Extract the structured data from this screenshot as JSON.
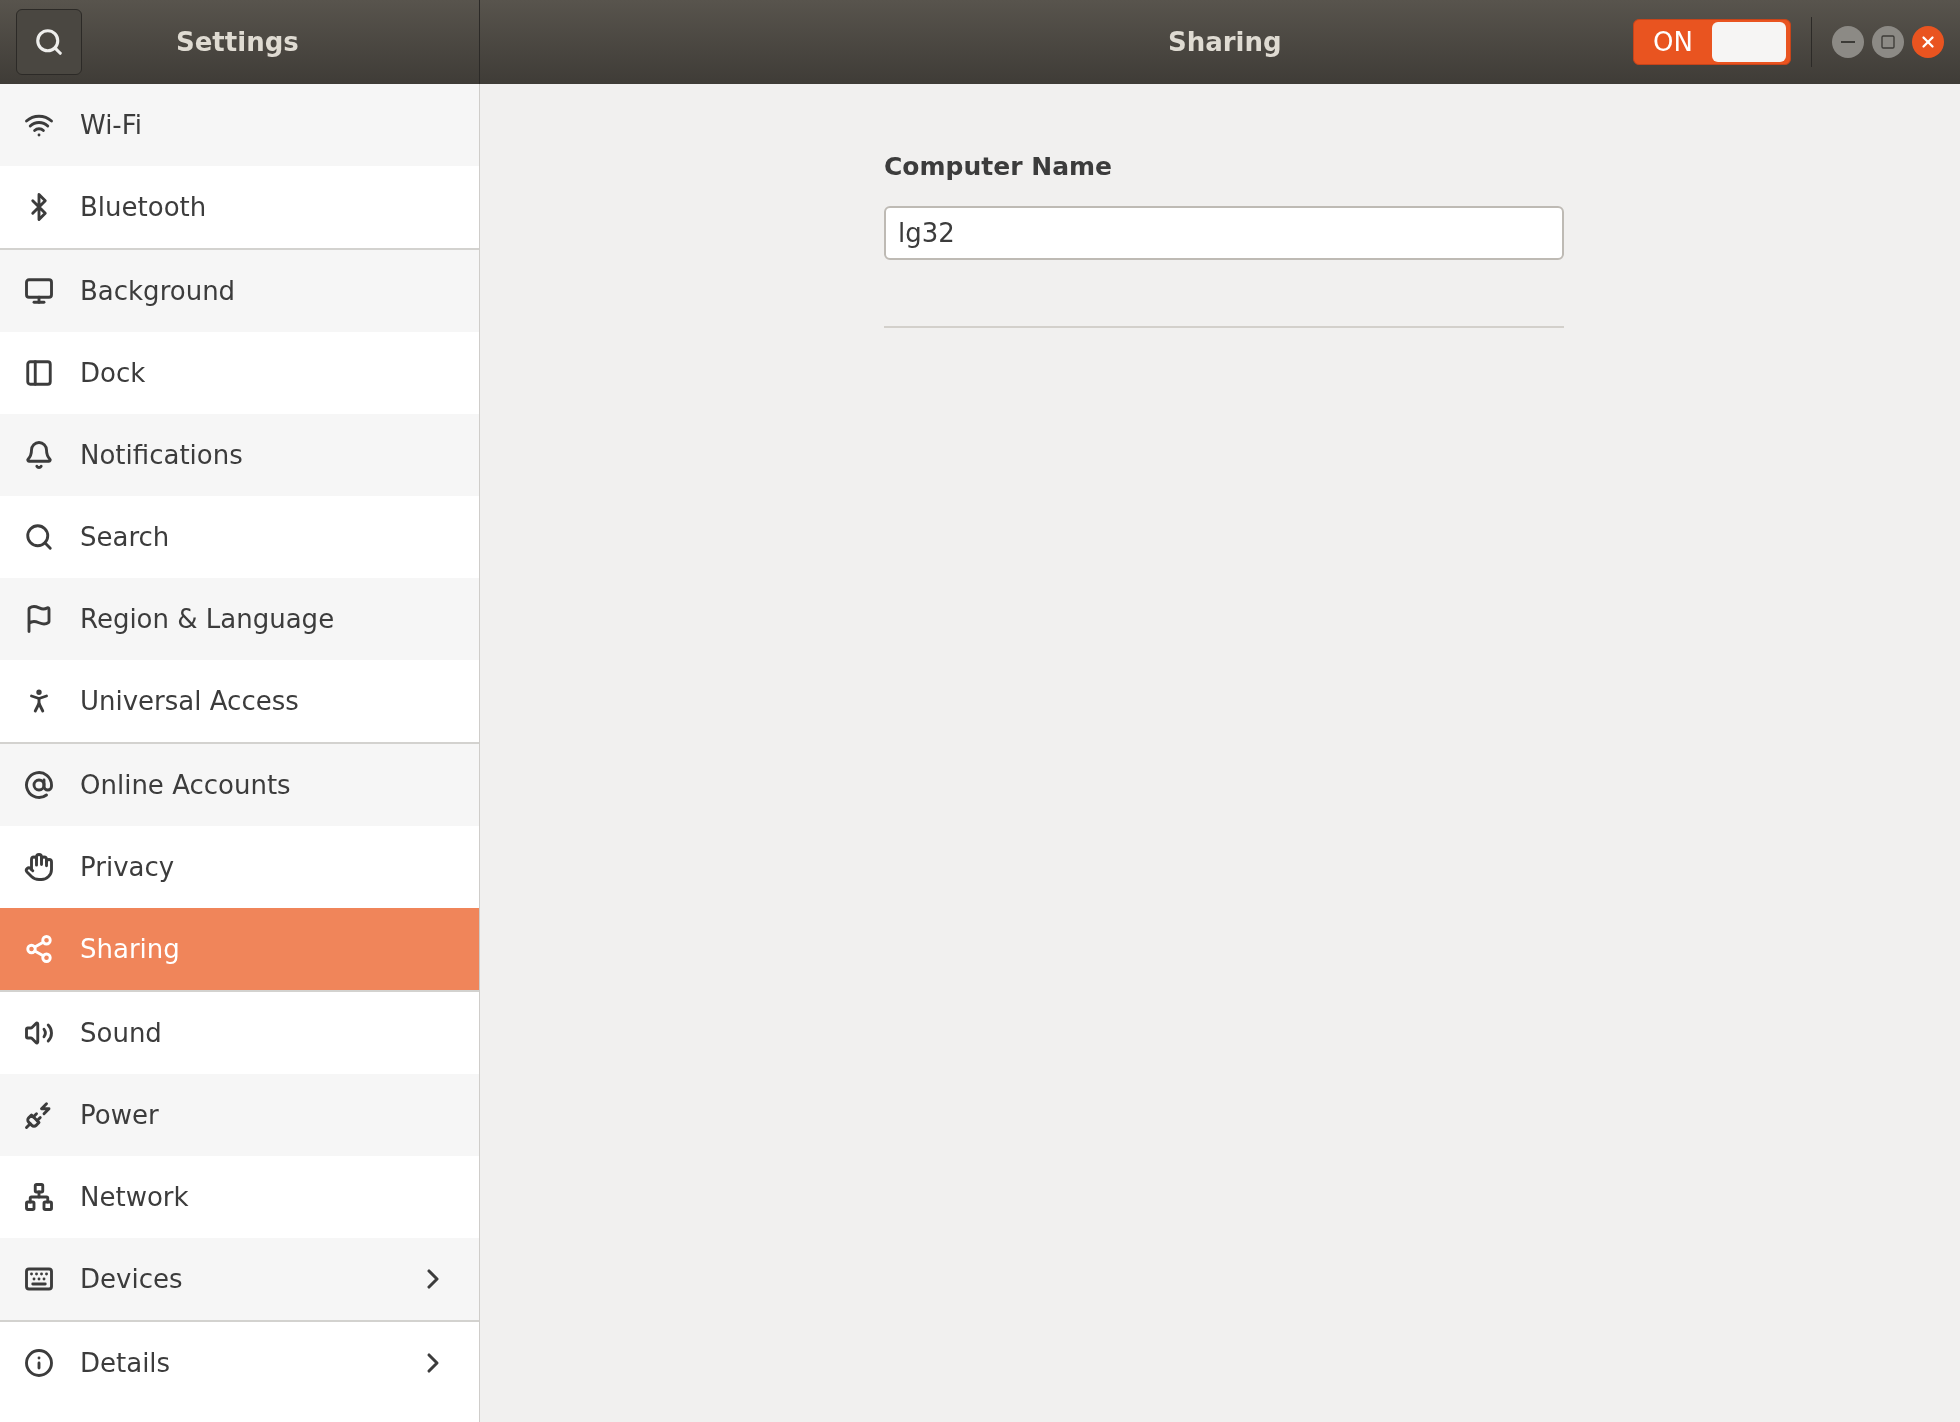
{
  "header": {
    "sidebar_title": "Settings",
    "page_title": "Sharing",
    "switch": {
      "label": "ON",
      "on": true
    }
  },
  "sidebar": {
    "groups": [
      {
        "items": [
          {
            "label": "Wi-Fi",
            "selected": false,
            "has_submenu": false
          },
          {
            "label": "Bluetooth",
            "selected": false,
            "has_submenu": false
          }
        ]
      },
      {
        "items": [
          {
            "label": "Background",
            "selected": false,
            "has_submenu": false
          },
          {
            "label": "Dock",
            "selected": false,
            "has_submenu": false
          },
          {
            "label": "Notifications",
            "selected": false,
            "has_submenu": false
          },
          {
            "label": "Search",
            "selected": false,
            "has_submenu": false
          },
          {
            "label": "Region & Language",
            "selected": false,
            "has_submenu": false
          },
          {
            "label": "Universal Access",
            "selected": false,
            "has_submenu": false
          }
        ]
      },
      {
        "items": [
          {
            "label": "Online Accounts",
            "selected": false,
            "has_submenu": false
          },
          {
            "label": "Privacy",
            "selected": false,
            "has_submenu": false
          },
          {
            "label": "Sharing",
            "selected": true,
            "has_submenu": false
          }
        ]
      },
      {
        "items": [
          {
            "label": "Sound",
            "selected": false,
            "has_submenu": false
          },
          {
            "label": "Power",
            "selected": false,
            "has_submenu": false
          },
          {
            "label": "Network",
            "selected": false,
            "has_submenu": false
          },
          {
            "label": "Devices",
            "selected": false,
            "has_submenu": true
          }
        ]
      },
      {
        "items": [
          {
            "label": "Details",
            "selected": false,
            "has_submenu": true
          }
        ]
      }
    ]
  },
  "content": {
    "computer_name": {
      "label": "Computer Name",
      "value": "lg32"
    }
  }
}
